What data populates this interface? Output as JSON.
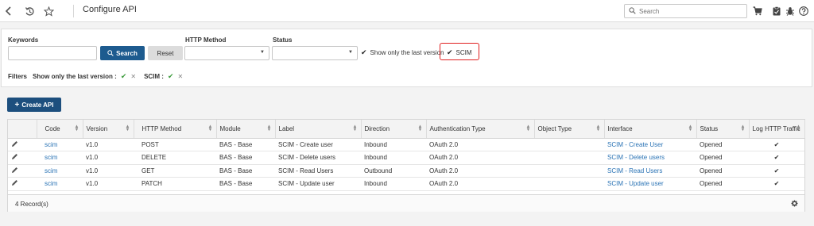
{
  "header": {
    "title": "Configure API",
    "search_placeholder": "Search"
  },
  "filter": {
    "keywords_label": "Keywords",
    "keywords_value": "",
    "search_button": "Search",
    "reset_button": "Reset",
    "http_method_label": "HTTP Method",
    "http_method_value": "",
    "status_label": "Status",
    "status_value": "",
    "last_version_label": "Show only the last version",
    "last_version_checked": true,
    "scim_label": "SCIM",
    "scim_checked": true,
    "filters_label": "Filters",
    "chip_last_version": "Show only the last version :",
    "chip_scim": "SCIM :"
  },
  "create_button": "Create API",
  "table": {
    "columns": [
      "Code",
      "Version",
      "HTTP Method",
      "Module",
      "Label",
      "Direction",
      "Authentication Type",
      "Object Type",
      "Interface",
      "Status",
      "Log HTTP Traffic"
    ],
    "rows": [
      {
        "code": "scim",
        "version": "v1.0",
        "method": "POST",
        "module": "BAS - Base",
        "label": "SCIM - Create user",
        "direction": "Inbound",
        "auth": "OAuth 2.0",
        "object_type": "",
        "interface": "SCIM - Create User",
        "status": "Opened",
        "log": "✔"
      },
      {
        "code": "scim",
        "version": "v1.0",
        "method": "DELETE",
        "module": "BAS - Base",
        "label": "SCIM - Delete users",
        "direction": "Inbound",
        "auth": "OAuth 2.0",
        "object_type": "",
        "interface": "SCIM - Delete users",
        "status": "Opened",
        "log": "✔"
      },
      {
        "code": "scim",
        "version": "v1.0",
        "method": "GET",
        "module": "BAS - Base",
        "label": "SCIM - Read Users",
        "direction": "Outbound",
        "auth": "OAuth 2.0",
        "object_type": "",
        "interface": "SCIM - Read Users",
        "status": "Opened",
        "log": "✔"
      },
      {
        "code": "scim",
        "version": "v1.0",
        "method": "PATCH",
        "module": "BAS - Base",
        "label": "SCIM - Update user",
        "direction": "Inbound",
        "auth": "OAuth 2.0",
        "object_type": "",
        "interface": "SCIM - Update user",
        "status": "Opened",
        "log": "✔"
      }
    ],
    "record_count": "4 Record(s)"
  },
  "icons": {
    "back": "chevron-left-icon",
    "history": "history-icon",
    "favorite": "star-icon",
    "search": "search-icon",
    "cart": "cart-icon",
    "clipboard": "clipboard-icon",
    "bug": "bug-icon",
    "help": "help-icon",
    "edit": "pencil-icon",
    "settings": "gear-icon"
  },
  "colors": {
    "primary": "#1d5b8f",
    "link": "#2a73b5",
    "highlight": "#e02020",
    "check_ok": "#3a9a3a"
  }
}
